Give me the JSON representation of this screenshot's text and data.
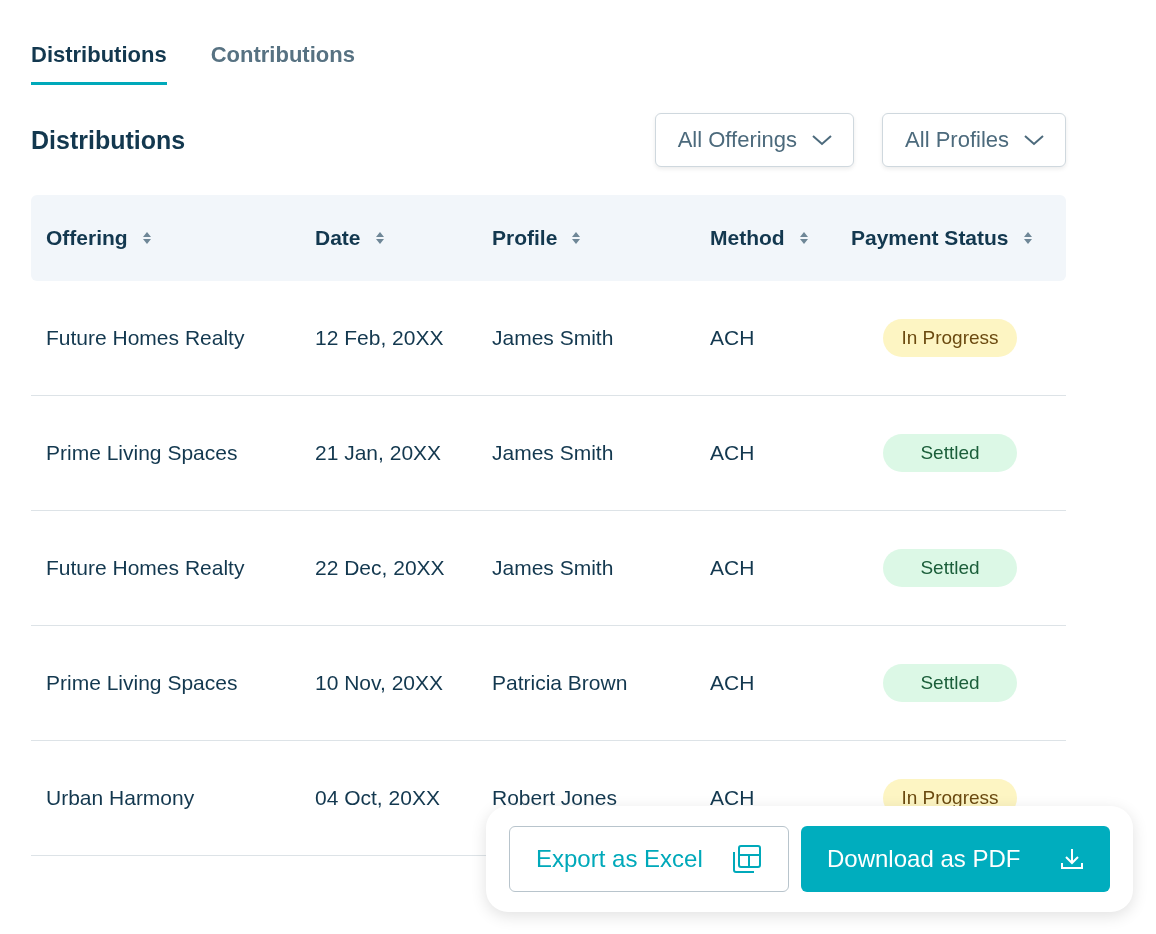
{
  "tabs": [
    {
      "label": "Distributions",
      "selected": true
    },
    {
      "label": "Contributions",
      "selected": false
    }
  ],
  "section_title": "Distributions",
  "filters": [
    {
      "label": "All Offerings"
    },
    {
      "label": "All Profiles"
    }
  ],
  "table": {
    "columns": [
      "Offering",
      "Date",
      "Profile",
      "Method",
      "Payment Status"
    ],
    "rows": [
      {
        "offering": "Future Homes Realty",
        "date": "12 Feb, 20XX",
        "profile": "James Smith",
        "method": "ACH",
        "status": {
          "label": "In Progress",
          "kind": "in_progress"
        }
      },
      {
        "offering": "Prime Living Spaces",
        "date": "21 Jan, 20XX",
        "profile": "James Smith",
        "method": "ACH",
        "status": {
          "label": "Settled",
          "kind": "settled"
        }
      },
      {
        "offering": "Future Homes Realty",
        "date": "22 Dec, 20XX",
        "profile": "James Smith",
        "method": "ACH",
        "status": {
          "label": "Settled",
          "kind": "settled"
        }
      },
      {
        "offering": "Prime Living Spaces",
        "date": "10 Nov, 20XX",
        "profile": "Patricia Brown",
        "method": "ACH",
        "status": {
          "label": "Settled",
          "kind": "settled"
        }
      },
      {
        "offering": "Urban Harmony",
        "date": "04 Oct, 20XX",
        "profile": "Robert Jones",
        "method": "ACH",
        "status": {
          "label": "In Progress",
          "kind": "in_progress"
        }
      }
    ]
  },
  "actions": [
    {
      "label": "Export as Excel",
      "kind": "secondary"
    },
    {
      "label": "Download as PDF",
      "kind": "primary"
    }
  ]
}
